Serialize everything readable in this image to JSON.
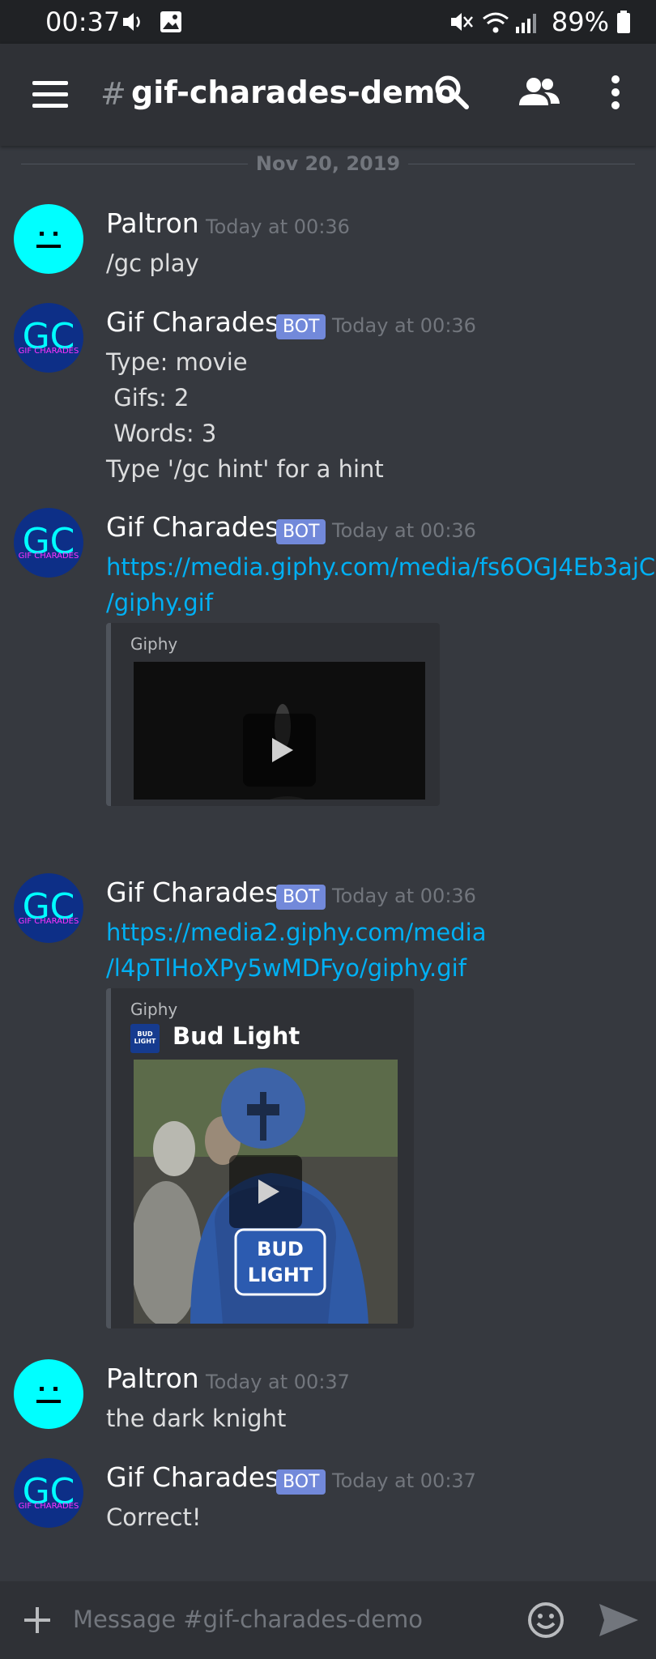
{
  "status": {
    "time": "00:37",
    "battery": "89%"
  },
  "header": {
    "hash": "#",
    "channel_name": "gif-charades-demo"
  },
  "date_divider": "Nov 20, 2019",
  "messages": [
    {
      "author": "Paltron",
      "time": "Today at 00:36",
      "lines": [
        "/gc play"
      ]
    },
    {
      "author": "Gif Charades",
      "bot_tag": "BOT",
      "time": "Today at 00:36",
      "lines": [
        "Type: movie",
        " Gifs: 2",
        " Words: 3",
        "Type '/gc hint' for a hint"
      ]
    },
    {
      "author": "Gif Charades",
      "bot_tag": "BOT",
      "time": "Today at 00:36",
      "link_lines": [
        "https://media.giphy.com/media/fs6OGJ4Eb3ajC",
        "/giphy.gif"
      ],
      "embed_provider": "Giphy"
    },
    {
      "author": "Gif Charades",
      "bot_tag": "BOT",
      "time": "Today at 00:36",
      "link_lines": [
        "https://media2.giphy.com/media",
        "/l4pTlHoXPy5wMDFyo/giphy.gif"
      ],
      "embed_provider": "Giphy",
      "embed_title": "Bud Light",
      "embed_logo_text": "BUD LIGHT",
      "gif_text": "BUD LIGHT"
    },
    {
      "author": "Paltron",
      "time": "Today at 00:37",
      "lines": [
        "the dark knight"
      ]
    },
    {
      "author": "Gif Charades",
      "bot_tag": "BOT",
      "time": "Today at 00:37",
      "lines": [
        "Correct!"
      ]
    }
  ],
  "avatar": {
    "gc_letters": "GC",
    "gc_subtext": "GIF CHARADES"
  },
  "input": {
    "placeholder": "Message #gif-charades-demo"
  },
  "icons": {
    "volume": "volume-icon",
    "image": "image-icon",
    "mute": "mute-icon",
    "wifi": "wifi-icon",
    "signal": "signal-icon",
    "battery": "battery-icon",
    "menu": "hamburger-menu-icon",
    "search": "search-icon",
    "members": "members-icon",
    "more": "more-vertical-icon",
    "add": "plus-icon",
    "emoji": "emoji-icon",
    "send": "send-icon",
    "play": "play-icon"
  },
  "colors": {
    "background": "#36393f",
    "header": "#2f3136",
    "link": "#00b0f4",
    "bot_tag": "#7289da",
    "paltron_avatar": "#00ffff",
    "gc_avatar": "#0d2f87"
  }
}
